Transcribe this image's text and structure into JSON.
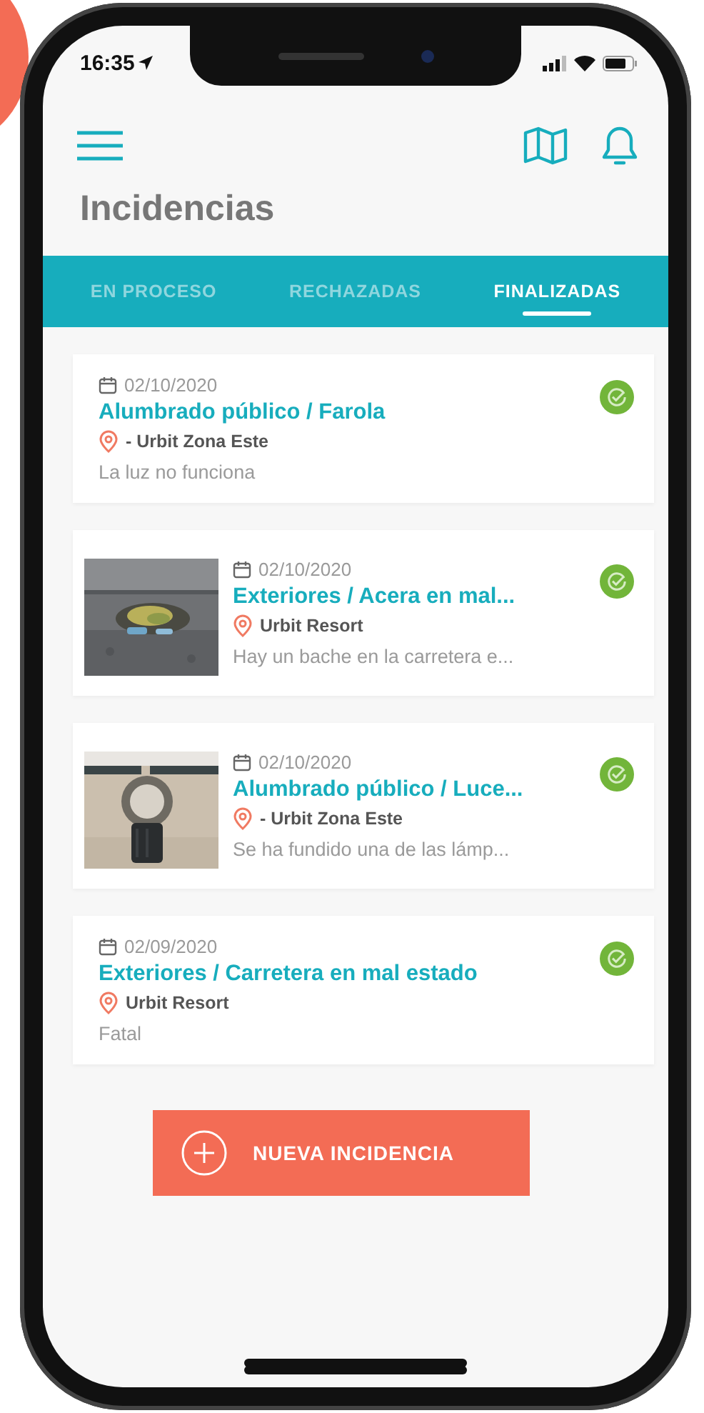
{
  "status_bar": {
    "time": "16:35"
  },
  "header": {
    "title": "Incidencias"
  },
  "tabs": [
    {
      "label": "EN PROCESO",
      "selected": false
    },
    {
      "label": "RECHAZADAS",
      "selected": false
    },
    {
      "label": "FINALIZADAS",
      "selected": true
    }
  ],
  "incidents": [
    {
      "date": "02/10/2020",
      "title": "Alumbrado público / Farola",
      "location": "- Urbit Zona Este",
      "description": "La luz no funciona",
      "resolved": true
    },
    {
      "date": "02/10/2020",
      "title": "Exteriores / Acera en mal...",
      "location": "Urbit Resort",
      "description": "Hay un bache en la carretera e...",
      "resolved": true
    },
    {
      "date": "02/10/2020",
      "title": "Alumbrado público / Luce...",
      "location": "- Urbit Zona Este",
      "description": "Se ha fundido una de las lámp...",
      "resolved": true
    },
    {
      "date": "02/09/2020",
      "title": "Exteriores / Carretera en mal estado",
      "location": "Urbit Resort",
      "description": "Fatal",
      "resolved": true
    }
  ],
  "button": {
    "label": "NUEVA INCIDENCIA"
  }
}
